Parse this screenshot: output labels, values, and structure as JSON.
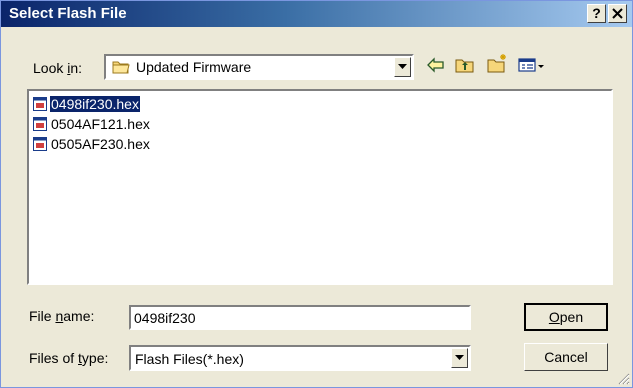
{
  "window": {
    "title": "Select Flash File",
    "help_label": "?",
    "close_label": "X"
  },
  "lookin": {
    "label_pre": "Look ",
    "label_key": "i",
    "label_post": "n:",
    "value": "Updated Firmware"
  },
  "toolbar": {
    "icons": [
      "back-arrow-icon",
      "up-folder-icon",
      "new-folder-icon",
      "view-menu-icon"
    ]
  },
  "files": [
    {
      "name": "0498if230.hex",
      "selected": true
    },
    {
      "name": "0504AF121.hex",
      "selected": false
    },
    {
      "name": "0505AF230.hex",
      "selected": false
    }
  ],
  "filename": {
    "label_pre": "File ",
    "label_key": "n",
    "label_post": "ame:",
    "value": "0498if230"
  },
  "filetype": {
    "label_pre": "Files of ",
    "label_key": "t",
    "label_post": "ype:",
    "value": "Flash Files(*.hex)"
  },
  "buttons": {
    "open_key": "O",
    "open_rest": "pen",
    "cancel": "Cancel"
  },
  "colors": {
    "title_start": "#0a246a",
    "title_end": "#a6caf0",
    "dialog_bg": "#ece9d8",
    "selection": "#0a246a"
  }
}
